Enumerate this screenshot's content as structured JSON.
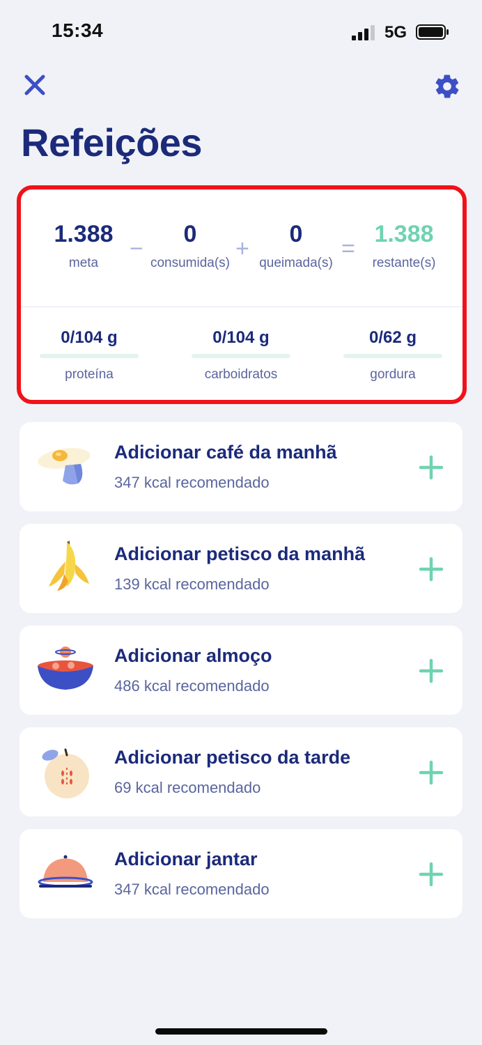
{
  "status_bar": {
    "time": "15:34",
    "network": "5G",
    "signal_icon": "signal-bars-icon",
    "battery_icon": "battery-icon"
  },
  "header": {
    "close_icon": "close-icon",
    "settings_icon": "gear-icon",
    "title": "Refeições"
  },
  "summary": {
    "goal": {
      "value": "1.388",
      "label": "meta"
    },
    "consumed": {
      "value": "0",
      "label": "consumida(s)"
    },
    "burned": {
      "value": "0",
      "label": "queimada(s)"
    },
    "remaining": {
      "value": "1.388",
      "label": "restante(s)"
    },
    "operators": {
      "minus": "−",
      "plus": "+",
      "equals": "="
    },
    "macros": [
      {
        "value": "0/104 g",
        "label": "proteína",
        "progress": 0
      },
      {
        "value": "0/104 g",
        "label": "carboidratos",
        "progress": 0
      },
      {
        "value": "0/62 g",
        "label": "gordura",
        "progress": 0
      }
    ]
  },
  "meals": [
    {
      "title": "Adicionar café da manhã",
      "subtitle": "347 kcal recomendado",
      "icon": "fried-egg-icon"
    },
    {
      "title": "Adicionar petisco da manhã",
      "subtitle": "139 kcal recomendado",
      "icon": "banana-icon"
    },
    {
      "title": "Adicionar almoço",
      "subtitle": "486 kcal recomendado",
      "icon": "bowl-icon"
    },
    {
      "title": "Adicionar petisco da tarde",
      "subtitle": "69 kcal recomendado",
      "icon": "apple-icon"
    },
    {
      "title": "Adicionar jantar",
      "subtitle": "347 kcal recomendado",
      "icon": "dinner-cloche-icon"
    }
  ],
  "colors": {
    "primary": "#1B2A7A",
    "accent": "#6FD3B0",
    "highlight_border": "#F0121A",
    "icon_blue": "#3D4FC4",
    "background": "#F1F2F8"
  }
}
